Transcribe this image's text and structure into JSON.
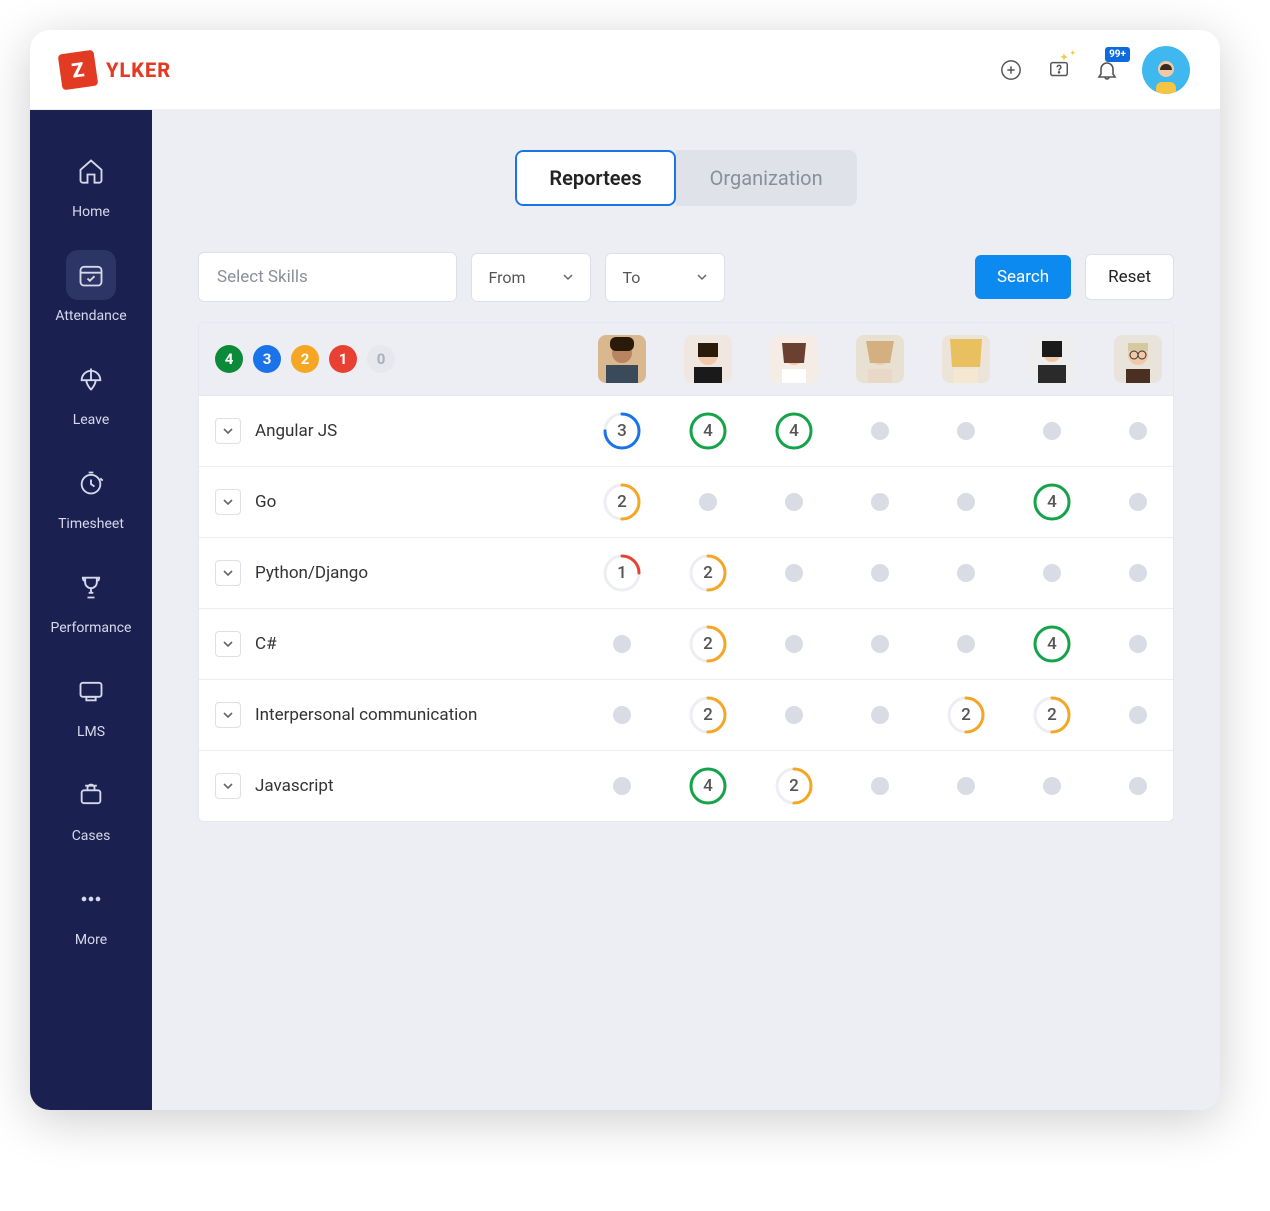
{
  "brand": {
    "mark": "Z",
    "name": "YLKER"
  },
  "topbar": {
    "notification_badge": "99+"
  },
  "sidebar": {
    "items": [
      {
        "label": "Home"
      },
      {
        "label": "Attendance"
      },
      {
        "label": "Leave"
      },
      {
        "label": "Timesheet"
      },
      {
        "label": "Performance"
      },
      {
        "label": "LMS"
      },
      {
        "label": "Cases"
      },
      {
        "label": "More"
      }
    ]
  },
  "tabs": {
    "reportees": "Reportees",
    "organization": "Organization"
  },
  "filters": {
    "select_placeholder": "Select Skills",
    "from": "From",
    "to": "To",
    "search": "Search",
    "reset": "Reset"
  },
  "legend": [
    "4",
    "3",
    "2",
    "1",
    "0"
  ],
  "colors": {
    "4": "#15a34a",
    "3": "#1a73e8",
    "2": "#f5a623",
    "1": "#e84133",
    "0": "#d9dce4"
  },
  "people_count": 7,
  "skills": [
    {
      "name": "Angular JS",
      "scores": [
        3,
        4,
        4,
        null,
        null,
        null,
        null
      ]
    },
    {
      "name": "Go",
      "scores": [
        2,
        null,
        null,
        null,
        null,
        4,
        null
      ]
    },
    {
      "name": "Python/Django",
      "scores": [
        1,
        2,
        null,
        null,
        null,
        null,
        null
      ]
    },
    {
      "name": "C#",
      "scores": [
        null,
        2,
        null,
        null,
        null,
        4,
        null
      ]
    },
    {
      "name": "Interpersonal communication",
      "scores": [
        null,
        2,
        null,
        null,
        2,
        2,
        null
      ]
    },
    {
      "name": "Javascript",
      "scores": [
        null,
        4,
        2,
        null,
        null,
        null,
        null
      ]
    }
  ]
}
